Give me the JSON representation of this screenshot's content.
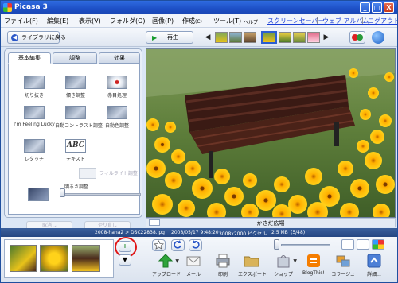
{
  "window": {
    "title": "Picasa 3",
    "min": "_",
    "max": "□",
    "close": "X"
  },
  "menu": {
    "file": "ファイル(F)",
    "edit": "編集(E)",
    "view": "表示(V)",
    "folder": "フォルダ(O)",
    "image": "画像(P)",
    "create": "作成",
    "create_sub": "(C)",
    "tools": "ツール(T)",
    "help": "ヘルプ",
    "screensaver": "スクリーンセーバー",
    "sep1": "|",
    "web_album": "ウェブ アルバム",
    "sep2": "|",
    "logout": "ログアウト"
  },
  "navbar": {
    "back_label": "ライブラリに戻る",
    "back_icon": "◀",
    "play_label": "再生",
    "play_icon": "▶",
    "prev": "◀",
    "next": "▶"
  },
  "edit_panel": {
    "tabs": [
      "基本編集",
      "調整",
      "効果"
    ],
    "tools": {
      "crop": "切り抜き",
      "straighten": "傾き調整",
      "redeye": "赤目処理",
      "feeling_lucky": "I'm Feeling Lucky",
      "auto_contrast": "自動コントラスト調整",
      "auto_color": "自動色調整",
      "retouch": "レタッチ",
      "text": "テキスト",
      "text_icon": "ABC",
      "fill_light": "フィルライト調整"
    },
    "brightness_label": "明るさ調整",
    "fill_light_level": 0,
    "undo": "取消し",
    "redo": "やり直し"
  },
  "caption": {
    "dots": "...",
    "text": "かさだ広場"
  },
  "status": {
    "path": "2008-hana2 > DSC22838.jpg",
    "date": "2008/05/17 9:48:20",
    "size": "3008x2000 ピクセル",
    "filesize": "2.5 MB",
    "count": "(5/48)"
  },
  "tray": {
    "add_icon": "+",
    "menu_icon": "▼",
    "zoom_level": 0,
    "actions": {
      "upload": "アップロード",
      "email": "メール",
      "print": "印刷",
      "export": "エクスポート",
      "shop": "ショップ",
      "blogthis": "BlogThis!",
      "collage": "コラージュ",
      "details": "詳細..."
    },
    "dropdown": "▼"
  }
}
